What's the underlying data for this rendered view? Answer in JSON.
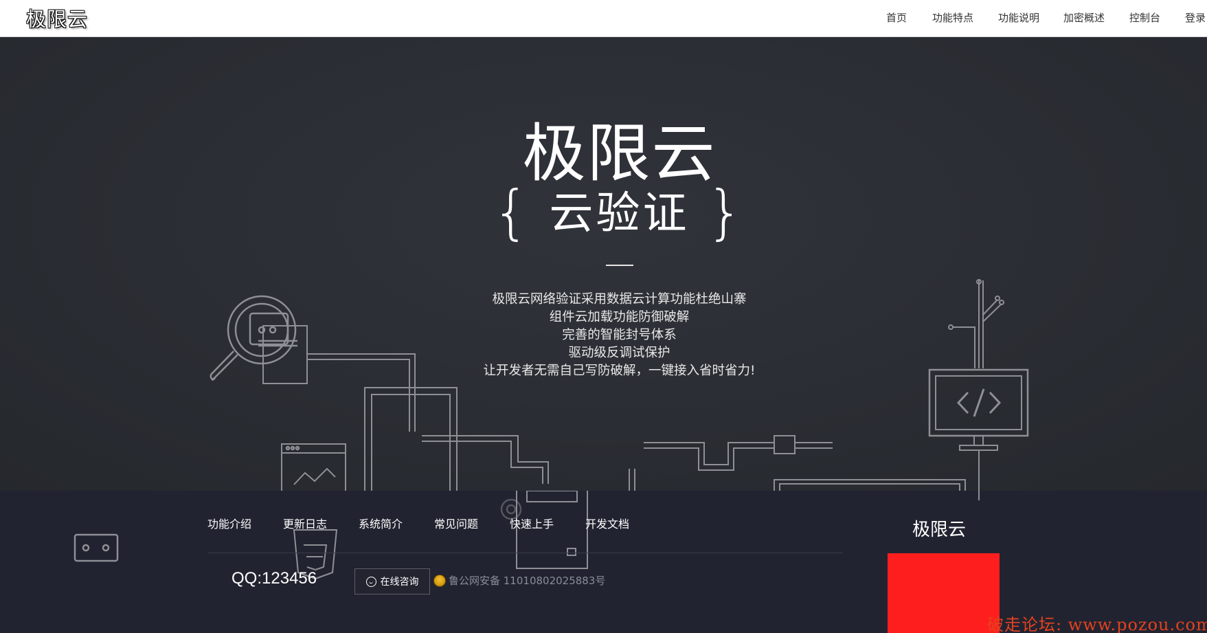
{
  "header": {
    "logo": "极限云",
    "nav": [
      {
        "label": "首页"
      },
      {
        "label": "功能特点"
      },
      {
        "label": "功能说明"
      },
      {
        "label": "加密概述"
      },
      {
        "label": "控制台"
      },
      {
        "label": "登录"
      }
    ]
  },
  "hero": {
    "title": "极限云",
    "subtitle_open": "{",
    "subtitle": "云验证",
    "subtitle_close": "}",
    "description": [
      "极限云网络验证采用数据云计算功能杜绝山寨",
      "组件云加载功能防御破解",
      "完善的智能封号体系",
      "驱动级反调试保护",
      "让开发者无需自己写防破解，一键接入省时省力!"
    ]
  },
  "footer": {
    "links": [
      {
        "label": "功能介绍"
      },
      {
        "label": "更新日志"
      },
      {
        "label": "系统简介"
      },
      {
        "label": "常见问题"
      },
      {
        "label": "快速上手"
      },
      {
        "label": "开发文档"
      }
    ],
    "qq": "QQ:123456",
    "consult_label": "在线咨询",
    "police_record": "鲁公网安备 11010802025883号",
    "brand": "极限云"
  },
  "watermark": "破走论坛: www.pozou.com",
  "colors": {
    "header_bg": "#ffffff",
    "hero_bg": "#2a2d33",
    "footer_bg": "#222330",
    "line_art": "#8e9096",
    "red_block": "#ff1e1e",
    "watermark": "#e3421f"
  }
}
